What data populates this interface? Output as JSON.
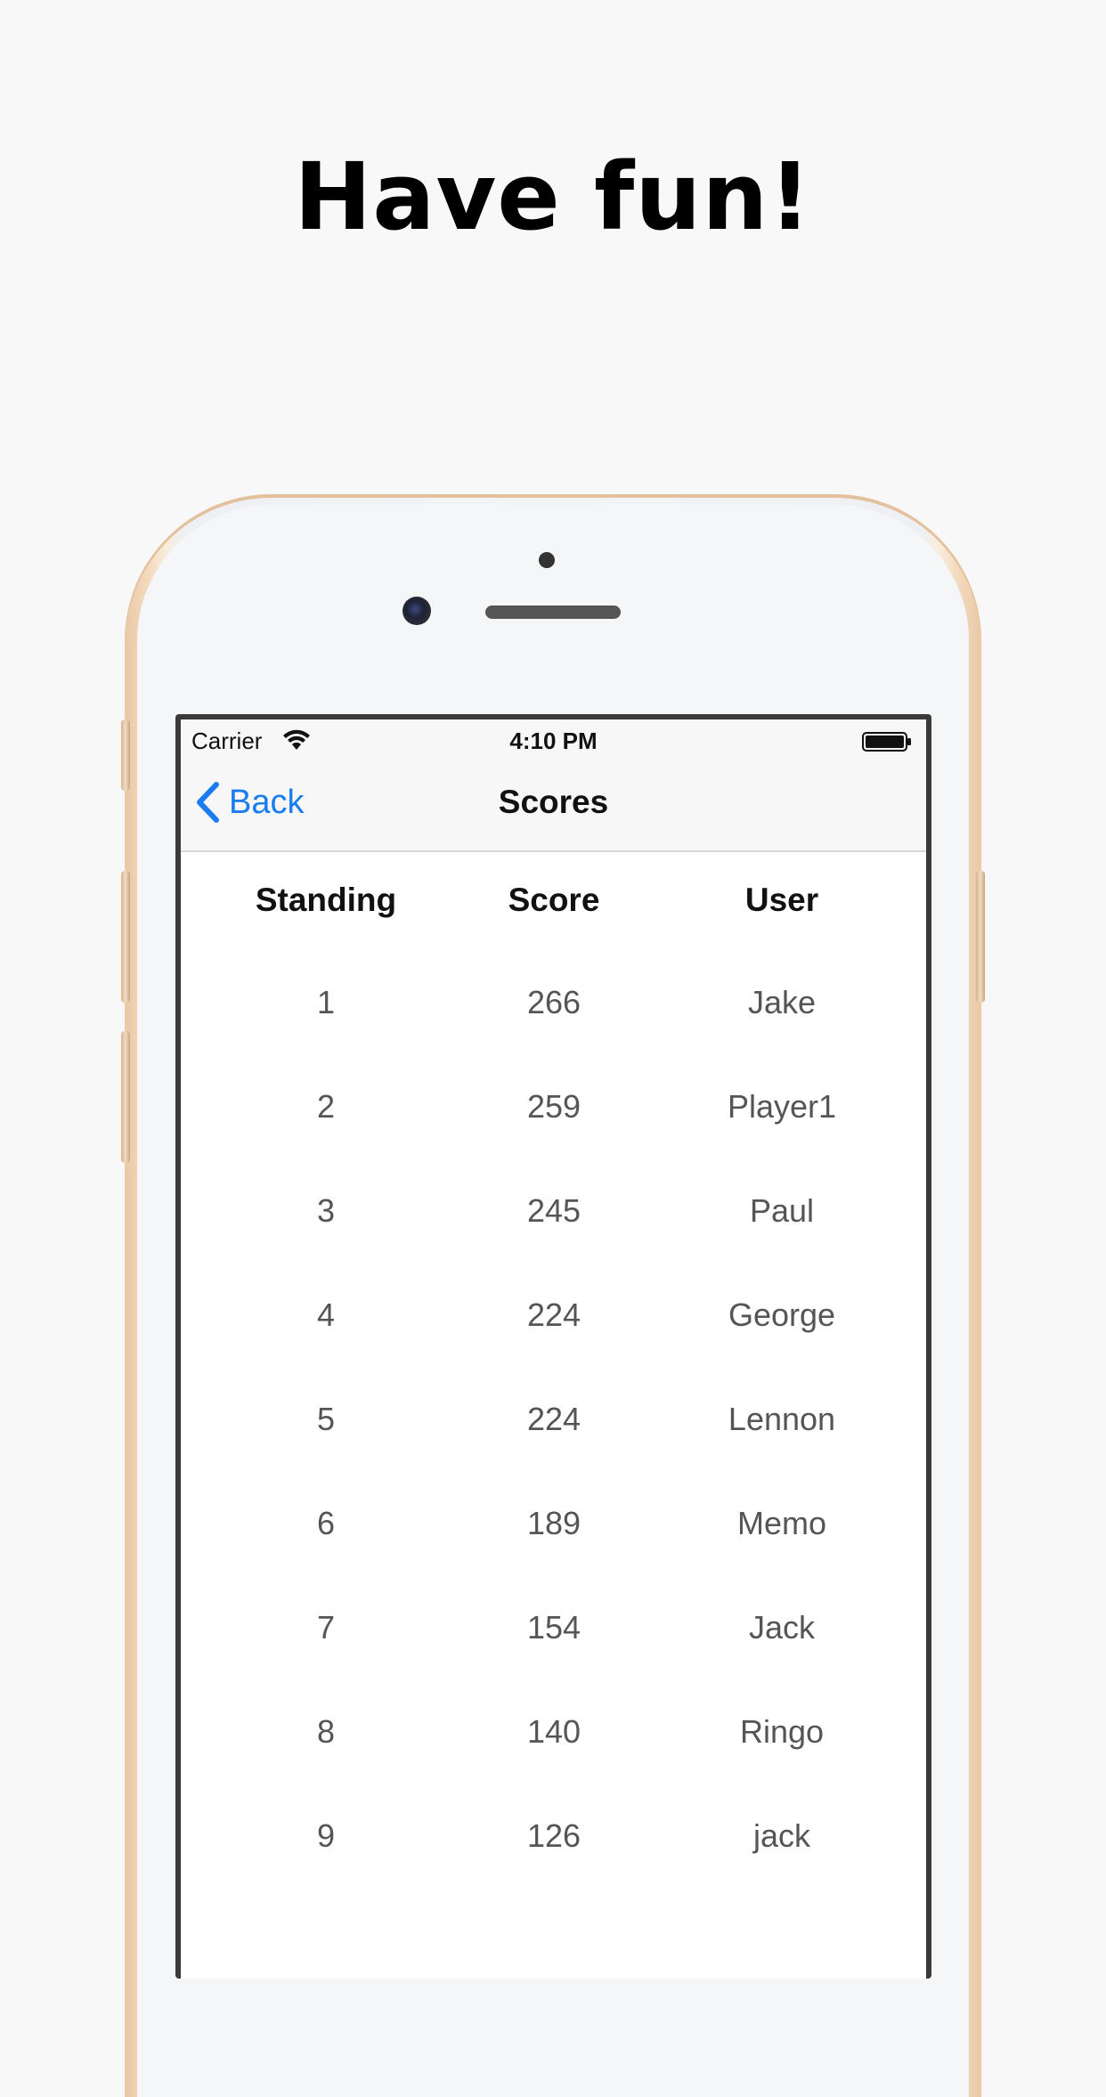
{
  "headline": "Have fun!",
  "status_bar": {
    "carrier": "Carrier",
    "time": "4:10 PM"
  },
  "nav": {
    "back_label": "Back",
    "title": "Scores"
  },
  "table": {
    "headers": [
      "Standing",
      "Score",
      "User"
    ],
    "rows": [
      [
        "1",
        "266",
        "Jake"
      ],
      [
        "2",
        "259",
        "Player1"
      ],
      [
        "3",
        "245",
        "Paul"
      ],
      [
        "4",
        "224",
        "George"
      ],
      [
        "5",
        "224",
        "Lennon"
      ],
      [
        "6",
        "189",
        "Memo"
      ],
      [
        "7",
        "154",
        "Jack"
      ],
      [
        "8",
        "140",
        "Ringo"
      ],
      [
        "9",
        "126",
        "jack"
      ]
    ]
  },
  "colors": {
    "accent": "#1a7cf0",
    "background": "#f8f8f9",
    "phone_frame": "#e9c9a6"
  }
}
